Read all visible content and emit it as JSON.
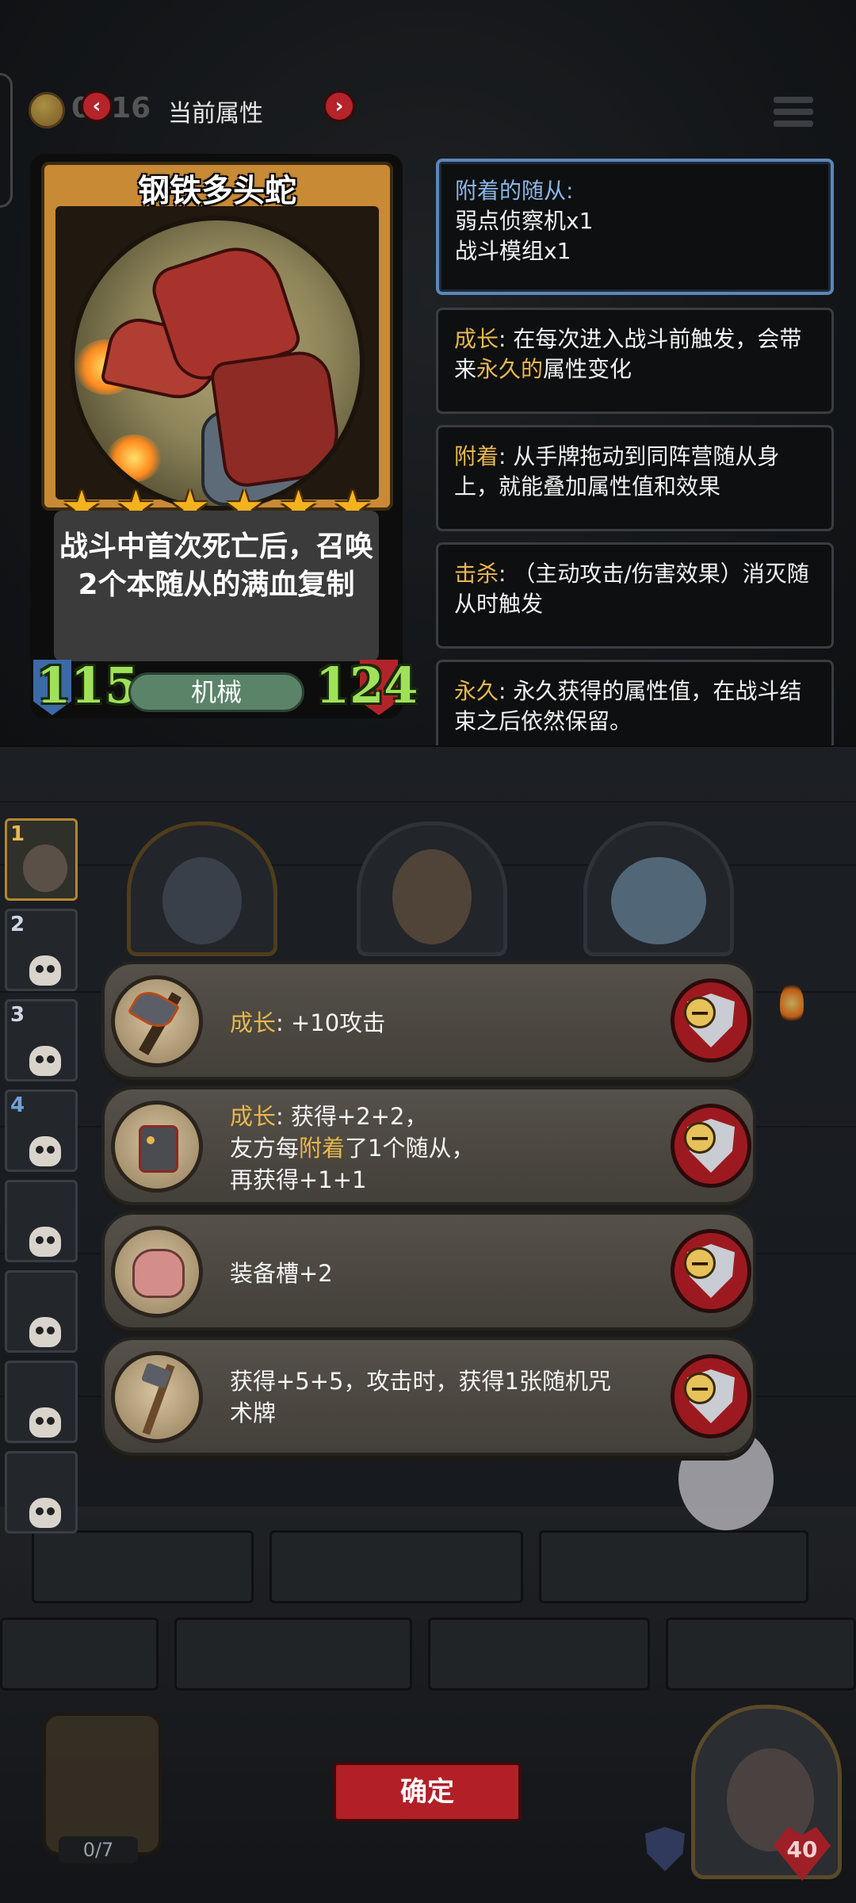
{
  "top_bar": {
    "coin_value": "0016",
    "title": "当前属性",
    "prev_arrow": "‹",
    "next_arrow": "›"
  },
  "card": {
    "name": "钢铁多头蛇",
    "star_count": 6,
    "star_glyph": "★",
    "description": "战斗中首次死亡后，召唤2个本随从的满血复制",
    "attack": "115",
    "health": "124",
    "tribe": "机械"
  },
  "info": {
    "attached_title": "附着的随从:",
    "attached_items": [
      "弱点侦察机x1",
      "战斗模组x1"
    ],
    "keywords": [
      {
        "term": "成长",
        "text_a": ": 在每次进入战斗前触发，会带来",
        "highlight": "永久的",
        "text_b": "属性变化"
      },
      {
        "term": "附着",
        "text_a": ": 从手牌拖动到同阵营随从身上，就能叠加属性值和效果",
        "highlight": "",
        "text_b": ""
      },
      {
        "term": "击杀",
        "text_a": ": （主动攻击/伤害效果）消灭随从时触发",
        "highlight": "",
        "text_b": ""
      },
      {
        "term": "永久",
        "text_a": ": 永久获得的属性值，在战斗结束之后依然保留。",
        "highlight": "",
        "text_b": ""
      }
    ]
  },
  "lineup": {
    "slots": [
      "1",
      "2",
      "3",
      "4",
      "",
      "",
      "",
      ""
    ]
  },
  "effects": [
    {
      "icon": "axe-icon",
      "line1_kw": "成长",
      "line1": ": +10攻击",
      "line2_a": "",
      "line2_kw": "",
      "line2_b": "",
      "line3": ""
    },
    {
      "icon": "robot-icon",
      "line1_kw": "成长",
      "line1": ": 获得+2+2，",
      "line2_a": "友方每",
      "line2_kw": "附着",
      "line2_b": "了1个随从，",
      "line3": "再获得+1+1"
    },
    {
      "icon": "bag-icon",
      "line1_kw": "",
      "line1": "装备槽+2",
      "line2_a": "",
      "line2_kw": "",
      "line2_b": "",
      "line3": ""
    },
    {
      "icon": "staff-icon",
      "line1_kw": "",
      "line1": "获得+5+5，攻击时，获得1张随机咒",
      "line2_a": "术牌",
      "line2_kw": "",
      "line2_b": "",
      "line3": ""
    }
  ],
  "bottom": {
    "confirm_label": "确定",
    "deck_count": "0/7",
    "hero_health": "40"
  },
  "colors": {
    "keyword": "#e6b84e",
    "attached_title": "#8bb6e6",
    "attack_green": "#9fe25a",
    "confirm_red": "#b21f26"
  }
}
